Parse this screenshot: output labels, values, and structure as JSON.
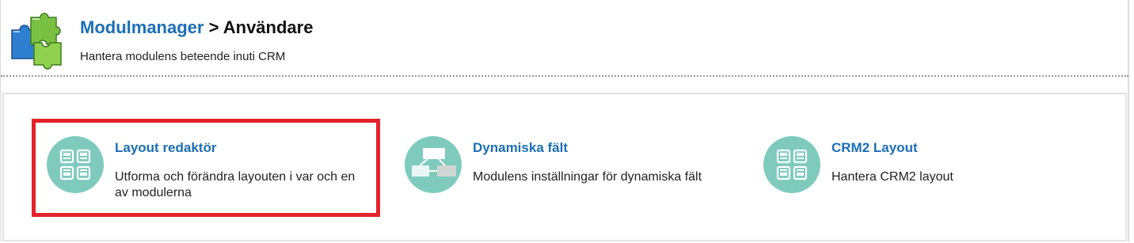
{
  "header": {
    "breadcrumb_link": "Modulmanager",
    "breadcrumb_separator": ">",
    "breadcrumb_current": "Användare",
    "subtitle": "Hantera modulens beteende inuti CRM",
    "icon": "puzzle-pieces-icon"
  },
  "cards": [
    {
      "title": "Layout redaktör",
      "description": "Utforma och förändra layouten i var och en av modulerna",
      "icon": "layout-grid-icon",
      "highlighted": true
    },
    {
      "title": "Dynamiska fält",
      "description": "Modulens inställningar för dynamiska fält",
      "icon": "dynamic-fields-icon",
      "highlighted": false
    },
    {
      "title": "CRM2 Layout",
      "description": "Hantera CRM2 layout",
      "icon": "layout-grid-icon",
      "highlighted": false
    }
  ],
  "colors": {
    "link": "#1b6fb5",
    "icon_circle": "#7ecbbd",
    "highlight_border": "#e3222c"
  }
}
